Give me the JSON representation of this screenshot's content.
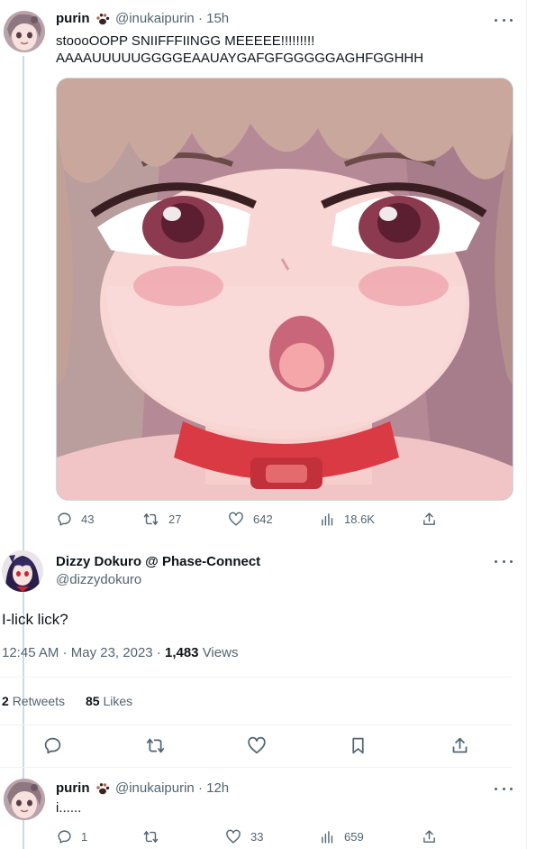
{
  "tweet1": {
    "name": "purin",
    "name_badge_icon": "paw-icon",
    "handle": "@inukaipurin",
    "sep": "·",
    "time": "15h",
    "text_line1": "stoooOOPP SNIIFFFIINGG MEEEEE!!!!!!!!!",
    "text_line2": "AAAAUUUUUGGGGEAAUAYGAFGFGGGGGAGHFGGHHH",
    "replies": "43",
    "retweets": "27",
    "likes": "642",
    "views": "18.6K"
  },
  "tweet2": {
    "name": "Dizzy Dokuro @ Phase-Connect",
    "handle": "@dizzydokuro",
    "text": "I-lick lick?",
    "time": "12:45 AM",
    "date": "May 23, 2023",
    "views_count": "1,483",
    "views_label": "Views",
    "retweets_count": "2",
    "retweets_label": "Retweets",
    "likes_count": "85",
    "likes_label": "Likes"
  },
  "tweet3": {
    "name": "purin",
    "name_badge_icon": "paw-icon",
    "handle": "@inukaipurin",
    "sep": "·",
    "time": "12h",
    "text": "i......",
    "replies": "1",
    "likes": "33",
    "views": "659"
  },
  "colors": {
    "text_primary": "#0f1419",
    "text_secondary": "#536471",
    "divider": "#eff3f4"
  }
}
